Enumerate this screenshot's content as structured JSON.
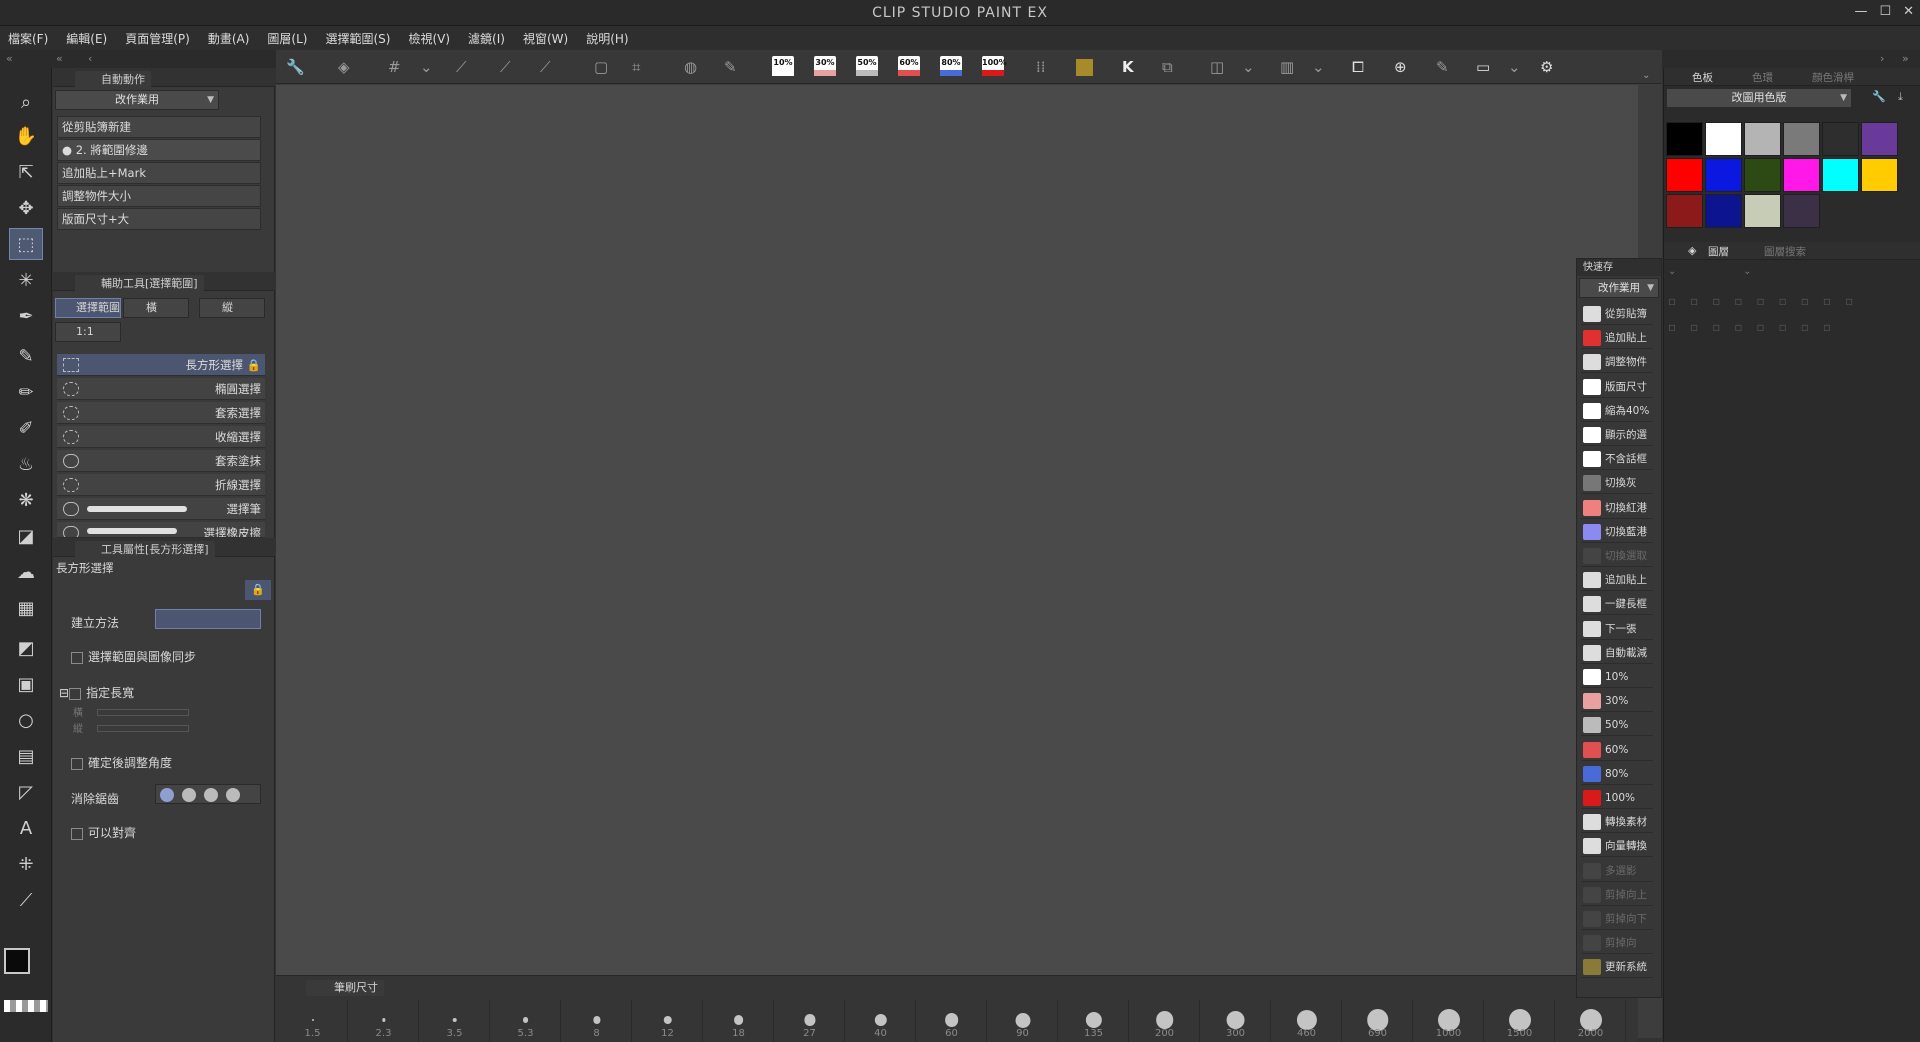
{
  "app": {
    "title": "CLIP STUDIO PAINT EX",
    "win_min": "—",
    "win_max": "☐",
    "win_close": "✕"
  },
  "menu": [
    "檔案(F)",
    "編輯(E)",
    "頁面管理(P)",
    "動畫(A)",
    "圖層(L)",
    "選擇範圍(S)",
    "檢視(V)",
    "濾鏡(I)",
    "視窗(W)",
    "說明(H)"
  ],
  "auto_action": {
    "tab": "自動動作",
    "set": "改作業用",
    "items": [
      "從剪貼簿新建",
      "2. 將範圍修邊",
      "追加貼上+Mark",
      "調整物件大小",
      "版面尺寸+大"
    ]
  },
  "subtool": {
    "tab": "輔助工具[選擇範圍]",
    "tabs": [
      "選擇範圍",
      "橫",
      "縱"
    ],
    "ratio": "1:1",
    "items": [
      "長方形選擇",
      "橢圓選擇",
      "套索選擇",
      "收縮選擇",
      "套索塗抹",
      "折線選擇",
      "選擇筆",
      "選擇橡皮擦"
    ]
  },
  "tool_property": {
    "tab": "工具屬性[長方形選擇]",
    "name": "長方形選擇",
    "create_method": "建立方法",
    "sync": "選擇範圍與圖像同步",
    "specify_size": "指定長寬",
    "w_label": "橫",
    "h_label": "縱",
    "adjust_angle": "確定後調整角度",
    "antialias": "消除鋸齒",
    "snap": "可以對齊"
  },
  "pct_buttons": [
    "10%",
    "30%",
    "50%",
    "60%",
    "80%",
    "100%"
  ],
  "pct_colors": [
    "#ffffff",
    "#e8a0a0",
    "#bbbbbb",
    "#e05050",
    "#4a6ad8",
    "#d81a1a"
  ],
  "brush_size": {
    "tab": "筆刷尺寸",
    "sizes": [
      "1.5",
      "2.3",
      "3.5",
      "5.3",
      "8",
      "12",
      "18",
      "27",
      "40",
      "60",
      "90",
      "135",
      "200",
      "300",
      "460",
      "690",
      "1000",
      "1500",
      "2000"
    ]
  },
  "quick_access": {
    "title": "快速存",
    "set": "改作業用",
    "items": [
      {
        "label": "從剪貼簿",
        "icon": "clipboard-icon",
        "c": "#ddd"
      },
      {
        "label": "追加貼上",
        "icon": "red-square-icon",
        "c": "#e03030"
      },
      {
        "label": "調整物件",
        "icon": "resize-icon",
        "c": "#ddd"
      },
      {
        "label": "版面尺寸",
        "icon": "canvas-size-icon",
        "c": "#fff"
      },
      {
        "label": "縮為40%",
        "icon": "40-percent-icon",
        "c": "#fff"
      },
      {
        "label": "顯示的選",
        "icon": "page-icon",
        "c": "#fff"
      },
      {
        "label": "不含話框",
        "icon": "page-icon",
        "c": "#fff"
      },
      {
        "label": "切換灰",
        "icon": "gray-circle-icon",
        "c": "#777"
      },
      {
        "label": "切換紅港",
        "icon": "red-circle-icon",
        "c": "#f08080"
      },
      {
        "label": "切換藍港",
        "icon": "blue-circle-icon",
        "c": "#8a8af0"
      },
      {
        "label": "切換選取",
        "icon": "dim-icon",
        "c": "#444"
      },
      {
        "label": "追加貼上",
        "icon": "paste-icon",
        "c": "#ddd"
      },
      {
        "label": "一鍵長框",
        "icon": "frame-icon",
        "c": "#ddd"
      },
      {
        "label": "下一張",
        "icon": "next-icon",
        "c": "#ddd"
      },
      {
        "label": "自動載減",
        "icon": "auto-icon",
        "c": "#ddd"
      },
      {
        "label": "10%",
        "icon": "pct-10-icon",
        "c": "#fff"
      },
      {
        "label": "30%",
        "icon": "pct-30-icon",
        "c": "#e8a0a0"
      },
      {
        "label": "50%",
        "icon": "pct-50-icon",
        "c": "#bbb"
      },
      {
        "label": "60%",
        "icon": "pct-60-icon",
        "c": "#e05050"
      },
      {
        "label": "80%",
        "icon": "pct-80-icon",
        "c": "#4a6ad8"
      },
      {
        "label": "100%",
        "icon": "pct-100-icon",
        "c": "#d81a1a"
      },
      {
        "label": "轉換素材",
        "icon": "convert-icon",
        "c": "#ddd"
      },
      {
        "label": "向量轉換",
        "icon": "vector-icon",
        "c": "#ddd"
      },
      {
        "label": "多選影",
        "icon": "dim-icon",
        "c": "#444"
      },
      {
        "label": "剪掉向上",
        "icon": "dim-icon",
        "c": "#444"
      },
      {
        "label": "剪掉向下",
        "icon": "dim-icon",
        "c": "#444"
      },
      {
        "label": "剪掉向",
        "icon": "dim-icon",
        "c": "#444"
      },
      {
        "label": "更新系統",
        "icon": "gold-icon",
        "c": "#8a7a3a"
      }
    ]
  },
  "color_set": {
    "tabs": [
      "色板",
      "色環",
      "顏色滑桿"
    ],
    "set": "改圖用色版",
    "swatches": [
      "#000000",
      "#ffffff",
      "#b4b4b4",
      "#7a7a7a",
      "#2e2e2e",
      "#6a3a9a",
      "#ff0000",
      "#0a18e0",
      "#2e4a14",
      "#ff18e8",
      "#00ffff",
      "#ffcc00",
      "#8c1a1a",
      "#0c1490",
      "#c6ccb6",
      "#3c3046"
    ]
  },
  "layer": {
    "tabs": [
      "圖層",
      "圖層搜索"
    ]
  }
}
